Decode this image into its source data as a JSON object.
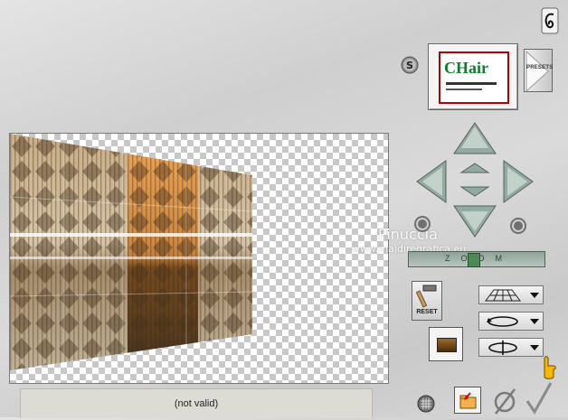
{
  "status": {
    "text": "(not valid)"
  },
  "presets": {
    "label": "PRESETS"
  },
  "reset": {
    "label": "RESET"
  },
  "watermark": {
    "name": "Pinuccia",
    "url": "www.maidiregrafica.eu"
  },
  "thumbnail": {
    "text": "CHair"
  },
  "zoom": {
    "label": "ZOOM",
    "level": 0.48
  },
  "colors": {
    "accent": "#d9a000",
    "arrow": "#8aa39a",
    "status_bg": "#dcdcd4"
  }
}
